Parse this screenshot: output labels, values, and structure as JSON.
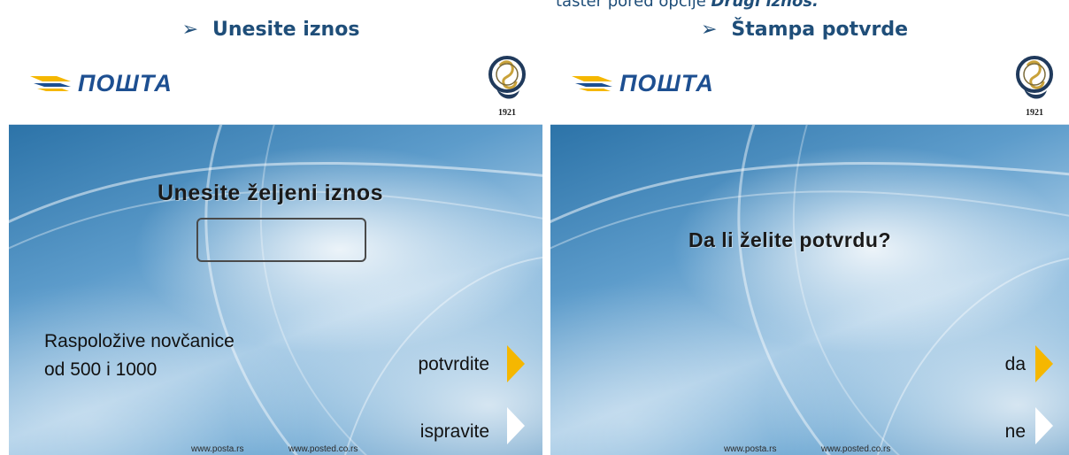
{
  "caption": {
    "prefix": "taster pored opcije ",
    "emphasis": "Drugi iznos."
  },
  "panels": [
    {
      "header": "Unesite iznos",
      "brand": "ПОШТА",
      "crest_year": "1921",
      "prompt": "Unesite željeni iznos",
      "amount_value": "",
      "info_line1": "Raspoložive novčanice",
      "info_line2": "od 500  i  1000",
      "confirm_label": "potvrdite",
      "correct_label": "ispravite",
      "footer_left": "www.posta.rs",
      "footer_right": "www.posted.co.rs"
    },
    {
      "header": "Štampa potvrde",
      "brand": "ПОШТА",
      "crest_year": "1921",
      "prompt": "Da li želite potvrdu?",
      "yes_label": "da",
      "no_label": "ne",
      "footer_left": "www.posta.rs",
      "footer_right": "www.posted.co.rs"
    }
  ],
  "colors": {
    "heading": "#1f4e79",
    "accent_arrow": "#f5b700",
    "brand_blue": "#1d4f91"
  },
  "icons": {
    "bullet": "arrowhead-bullet-icon",
    "brand_mark": "posta-wings-icon",
    "crest": "crest-1921-icon"
  }
}
